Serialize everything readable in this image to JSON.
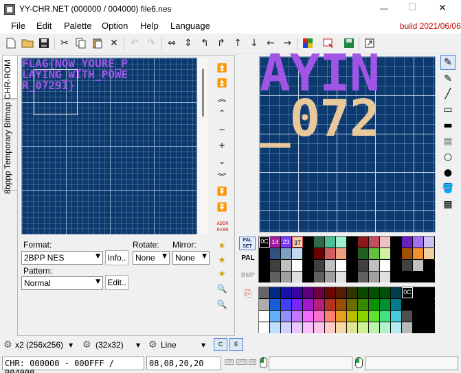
{
  "window": {
    "title": "YY-CHR.NET (000000 / 004000) file6.nes",
    "minimize": "—",
    "maximize": "☐",
    "close": "✕"
  },
  "menu": {
    "items": [
      "File",
      "Edit",
      "Palette",
      "Option",
      "Help",
      "Language"
    ],
    "build": "build 2021/06/06"
  },
  "side_tabs": {
    "chr_rom": "CHR-ROM",
    "bitmap": "8bppp Temporary Bitmap"
  },
  "chr_view": {
    "line1": "FLAG{NOW_YOURE_P",
    "line2": "LAYING_WITH_POWE",
    "line3": "R_07291}"
  },
  "editor": {
    "line1": "AYIN",
    "line2": "_072"
  },
  "format": {
    "label": "Format:",
    "value": "2BPP NES",
    "info_button": "Info..",
    "rotate_label": "Rotate:",
    "rotate_value": "None",
    "mirror_label": "Mirror:",
    "mirror_value": "None",
    "pattern_label": "Pattern:",
    "pattern_value": "Normal",
    "edit_button": "Edit.."
  },
  "scroll": {
    "addr": "ADDR",
    "addr_value": "0x80"
  },
  "palette_buttons": {
    "pal_set": "PAL SET",
    "pal": "PAL",
    "bmp": "BMP"
  },
  "palette_set": {
    "labels": [
      "0C",
      "14",
      "23",
      "37"
    ],
    "colors": [
      "#000000",
      "#a01c9c",
      "#7b3aff",
      "#f0d0b0"
    ]
  },
  "palette_highlight": "0C",
  "bottom_bar": {
    "zoom": "x2 (256x256)",
    "tile": "(32x32)",
    "line": "Line"
  },
  "status": {
    "chr": "CHR: 000000 - 000FFF / 004000",
    "coords": "08,08,20,20",
    "keys": [
      "Ctrl",
      "Shift",
      "Alt"
    ]
  },
  "colors": {
    "chr_bg": "#0c3a6f",
    "text_purple": "#a055e6",
    "editor_peach": "#e9c99b",
    "build_red": "#d00000"
  }
}
